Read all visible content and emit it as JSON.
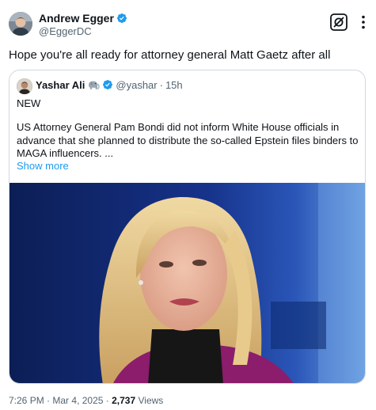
{
  "author": {
    "display_name": "Andrew Egger",
    "handle": "@EggerDC"
  },
  "tweet": {
    "text": "Hope you're all ready for attorney general Matt Gaetz after all"
  },
  "quote": {
    "display_name": "Yashar Ali",
    "emoji": "elephant",
    "handle": "@yashar",
    "separator": "·",
    "time": "15h",
    "label": "NEW",
    "body": "US Attorney General Pam Bondi did not inform White House officials in advance that she planned to distribute the so-called Epstein files binders to MAGA influencers. ...",
    "show_more": "Show more"
  },
  "meta": {
    "time": "7:26 PM",
    "separator": "·",
    "date": "Mar 4, 2025",
    "views_count": "2,737",
    "views_label": "Views"
  },
  "colors": {
    "verified_blue": "#1d9bf0",
    "text_secondary": "#536471",
    "link_blue": "#1d9bf0",
    "border": "#cfd9de"
  },
  "icons": [
    "verified-badge-icon",
    "grok-icon",
    "more-options-icon",
    "elephant-emoji-icon"
  ]
}
